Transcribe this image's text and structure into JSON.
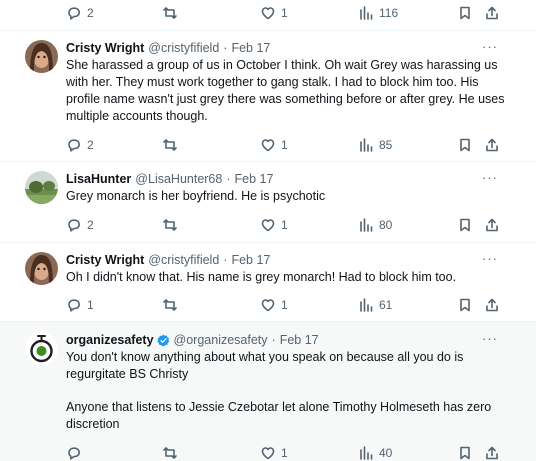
{
  "top_actions": {
    "replies": "2",
    "retweets": "",
    "likes": "1",
    "views": "116"
  },
  "tweets": [
    {
      "name": "Cristy Wright",
      "handle": "@cristyfifield",
      "date": "Feb 17",
      "text": [
        "She harassed a group of us in October I think. Oh wait Grey was harassing us with her. They must work together to gang stalk. I had to block him too. His profile name wasn't just grey there was something before or after grey. He uses multiple accounts though."
      ],
      "replies": "2",
      "retweets": "",
      "likes": "1",
      "views": "85"
    },
    {
      "name": "LisaHunter",
      "handle": "@LisaHunter68",
      "date": "Feb 17",
      "text": [
        "Grey monarch  is her boyfriend. He is psychotic"
      ],
      "replies": "2",
      "retweets": "",
      "likes": "1",
      "views": "80"
    },
    {
      "name": "Cristy Wright",
      "handle": "@cristyfifield",
      "date": "Feb 17",
      "text": [
        "Oh I didn't know that. His name is grey monarch! Had to block him too."
      ],
      "replies": "1",
      "retweets": "",
      "likes": "1",
      "views": "61"
    },
    {
      "name": "organizesafety",
      "handle": "@organizesafety",
      "date": "Feb 17",
      "text": [
        "You don't know anything about what you speak on because all you do is regurgitate BS Christy",
        "Anyone that listens to Jessie Czebotar let alone Timothy Holmeseth has zero discretion"
      ],
      "replies": "",
      "retweets": "",
      "likes": "1",
      "views": "40"
    }
  ],
  "colors": {
    "text": "#0f1419",
    "muted": "#536471",
    "verified": "#1d9bf0",
    "divider": "#eff3f4"
  }
}
